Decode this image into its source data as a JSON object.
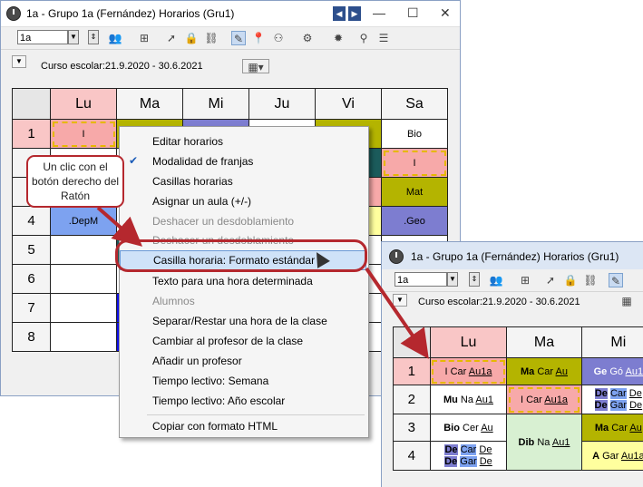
{
  "main_window": {
    "title": "1a - Grupo 1a (Fernández)  Horarios  (Gru1)",
    "class_select": "1a",
    "school_year": "Curso escolar:21.9.2020 - 30.6.2021",
    "days": [
      "Lu",
      "Ma",
      "Mi",
      "Ju",
      "Vi",
      "Sa"
    ],
    "periods": [
      "1",
      "2",
      "3",
      "4",
      "5",
      "6",
      "7",
      "8"
    ],
    "cells": {
      "lu1": "I",
      "lu4": ".DepM",
      "sa1": "Bio",
      "sa2": "I",
      "sa3": "Mat",
      "sa4": ".Geo"
    }
  },
  "context_menu": {
    "items": [
      {
        "label": "Editar horarios",
        "state": "normal"
      },
      {
        "label": "Modalidad de franjas",
        "state": "checked"
      },
      {
        "label": "Casillas horarias",
        "state": "normal"
      },
      {
        "label": "Asignar un aula (+/-)",
        "state": "normal"
      },
      {
        "label": "Deshacer un desdoblamiento",
        "state": "disabled"
      },
      {
        "label": "Deshacer un desdoblamiento",
        "state": "disabled"
      },
      {
        "label": "Casilla horaria: Formato estándar",
        "state": "highlighted"
      },
      {
        "label": "Texto para una hora determinada",
        "state": "normal"
      },
      {
        "label": "Alumnos",
        "state": "disabled"
      },
      {
        "label": "Separar/Restar una hora de la clase",
        "state": "normal"
      },
      {
        "label": "Cambiar al profesor de la clase",
        "state": "normal"
      },
      {
        "label": "Añadir un profesor",
        "state": "normal"
      },
      {
        "label": "Tiempo lectivo: Semana",
        "state": "normal"
      },
      {
        "label": "Tiempo lectivo: Año escolar",
        "state": "normal"
      },
      {
        "label": "Copiar con formato HTML",
        "state": "normal"
      }
    ]
  },
  "callout_text": "Un clic con el botón derecho del Ratón",
  "second_window": {
    "title": "1a - Grupo 1a (Fernández)  Horarios  (Gru1)",
    "class_select": "1a",
    "school_year": "Curso escolar:21.9.2020 - 30.6.2021",
    "days": [
      "Lu",
      "Ma",
      "Mi"
    ],
    "periods": [
      "1",
      "2",
      "3",
      "4"
    ],
    "r1": {
      "lu": {
        "s": "I",
        "t": "Car",
        "r": "Au1a"
      },
      "ma": {
        "s": "Ma",
        "t": "Car",
        "r": "Au"
      },
      "mi": {
        "s": "Ge",
        "t": "Gó",
        "r": "Au1"
      }
    },
    "r2": {
      "lu": {
        "s": "Mu",
        "t": "Na",
        "r": "Au1"
      },
      "ma": {
        "s": "I",
        "t": "Car",
        "r": "Au1a"
      },
      "mi_a": [
        "De",
        "Car",
        "De"
      ],
      "mi_b": [
        "De",
        "Gar",
        "De"
      ]
    },
    "r3": {
      "lu": {
        "s": "Bio",
        "t": "Cer",
        "r": "Au"
      },
      "ma": {
        "s": "Dib",
        "t": "Na",
        "r": "Au1"
      },
      "mi": {
        "s": "Ma",
        "t": "Car",
        "r": "Au"
      }
    },
    "r4": {
      "lu_a": [
        "De",
        "Car",
        "De"
      ],
      "lu_b": [
        "De",
        "Gar",
        "De"
      ],
      "mi": {
        "s": "A",
        "t": "Gar",
        "r": "Au1a"
      }
    }
  },
  "colors": {
    "accent_red": "#b5282e",
    "lu_header": "#f9c6c6",
    "olive": "#b4b400",
    "violet": "#7d7dd0",
    "blue": "#1010e8",
    "yellow": "#ffff9e",
    "green_light": "#d8f0d2",
    "teal_dark": "#1b5b5b"
  }
}
